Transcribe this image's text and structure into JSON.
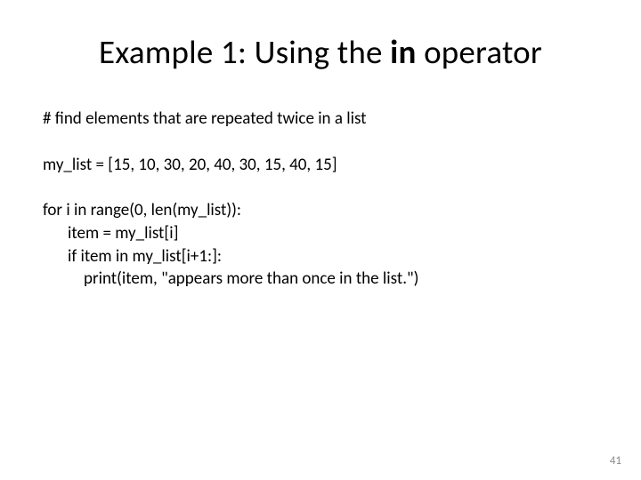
{
  "title_prefix": "Example 1: Using the ",
  "title_bold": "in",
  "title_suffix": " operator",
  "code": {
    "comment": "# find elements that are repeated twice in a list",
    "assign": "my_list = [15, 10, 30, 20, 40, 30, 15, 40, 15]",
    "for_line": "for i in range(0, len(my_list)):",
    "item_line": "item = my_list[i]",
    "if_line": "if item in my_list[i+1:]:",
    "print_line": "print(item, \"appears more than once in the list.\")"
  },
  "page_number": "41"
}
